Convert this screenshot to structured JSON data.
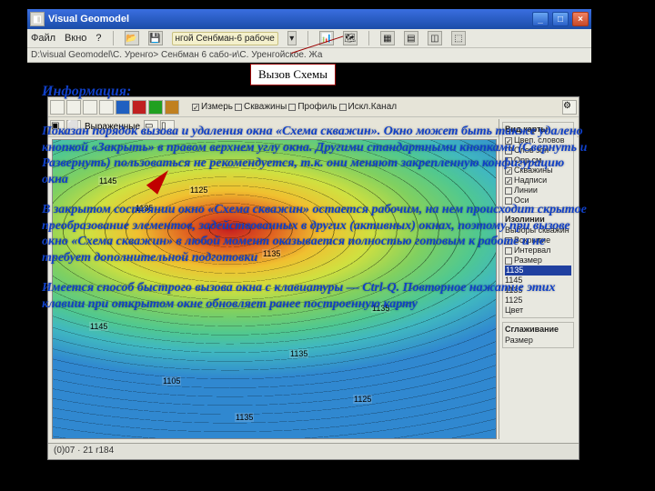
{
  "app": {
    "title": "Visual Geomodel",
    "icon": "app-icon"
  },
  "menu": {
    "file": "Файл",
    "window": "Вкно",
    "help": "?"
  },
  "toolbar": {
    "combo_text": "нгой Сенбман-6 рабоче",
    "path": "D:\\visual Geomodel\\С. Уренго> Сенбман 6 сабо-и\\С. Уренгойское. Жа"
  },
  "window_controls": {
    "min": "_",
    "max": "□",
    "close": "×"
  },
  "callout": {
    "label": "Вызов Схемы"
  },
  "inner": {
    "checks": {
      "izmer": "Измерь",
      "skvaz": "Скважины",
      "profil": "Профиль",
      "isklyuch": "Искл.Канал"
    },
    "right": {
      "vid_karty": "Вид карты",
      "opt1": "Цвеп. словов",
      "opt2": "Слов зон",
      "opt3": "Орр.см.",
      "opt4": "Скважины",
      "opt5": "Надписи",
      "opt6": "Линии",
      "opt7": "Оси",
      "isolines": "Изолинии",
      "vyd_skv": "Выборы скважин",
      "vscryte": "Вскрытие",
      "internal": "Интервал",
      "razmer": "Размер",
      "sel": "1135",
      "r1": "1145",
      "r2": "1135",
      "r3": "1125",
      "color": "Цвет",
      "sglazh": "Сглаживание",
      "razmer2": "Размер"
    },
    "status": "(0)07 · 21 r184",
    "contours": [
      "1145",
      "1135",
      "1125",
      "1135",
      "1145",
      "1105",
      "1135",
      "1135",
      "1135",
      "1125"
    ]
  },
  "overlay": {
    "heading": "Информация:",
    "p1": "Показан порядок вызова и удаления окна «Схема скважин». Окно может быть также удалено кнопкой «Закрыть» в правом верхнем углу окна. Другими стандартными кнопками (Свернуть и Развернуть) пользоваться не рекомендуется, т.к. они меняют закрепленную конфигурацию окна",
    "p2": "В закрытом состоянии окно «Схема скважин» остается рабочим, на нем происходит скрытое преобразование элементов, задействованных в других (активных) окнах, поэтому при вызове окно «Схема скважин» в любой момент оказывается полностью готовым к работе и не требует дополнительной подготовки",
    "p3": "Имеется способ быстрого вызова окна с клавиатуры — Ctrl-Q. Повторное нажатие этих клавиш при открытом окне обновляет ранее построенную карту"
  }
}
